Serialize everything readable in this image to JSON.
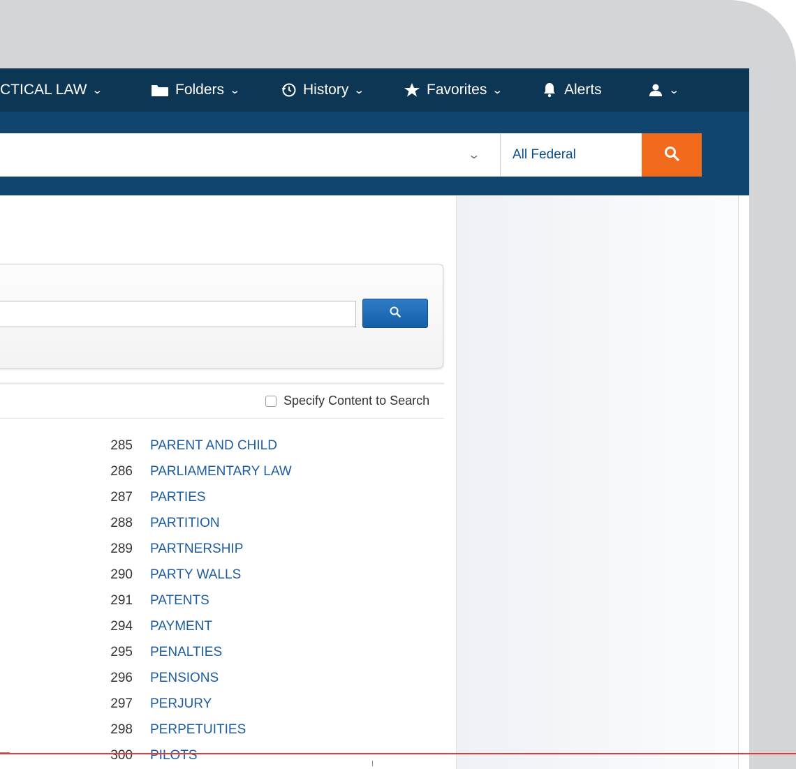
{
  "nav": {
    "practical_law_label": "CTICAL LAW",
    "folders_label": "Folders",
    "history_label": "History",
    "favorites_label": "Favorites",
    "alerts_label": "Alerts"
  },
  "search": {
    "jurisdiction": "All Federal",
    "accent_color": "#f26b1d"
  },
  "specify_content": {
    "label": "Specify Content to Search",
    "checked": false
  },
  "topics": [
    {
      "number": "285",
      "name": "PARENT AND CHILD"
    },
    {
      "number": "286",
      "name": "PARLIAMENTARY LAW"
    },
    {
      "number": "287",
      "name": "PARTIES"
    },
    {
      "number": "288",
      "name": "PARTITION"
    },
    {
      "number": "289",
      "name": "PARTNERSHIP"
    },
    {
      "number": "290",
      "name": "PARTY WALLS"
    },
    {
      "number": "291",
      "name": "PATENTS"
    },
    {
      "number": "294",
      "name": "PAYMENT"
    },
    {
      "number": "295",
      "name": "PENALTIES"
    },
    {
      "number": "296",
      "name": "PENSIONS"
    },
    {
      "number": "297",
      "name": "PERJURY"
    },
    {
      "number": "298",
      "name": "PERPETUITIES"
    },
    {
      "number": "300",
      "name": "PILOTS"
    }
  ],
  "colors": {
    "nav_bg": "#0d3655",
    "band_bg": "#0f456f",
    "link": "#1c5c9f"
  }
}
